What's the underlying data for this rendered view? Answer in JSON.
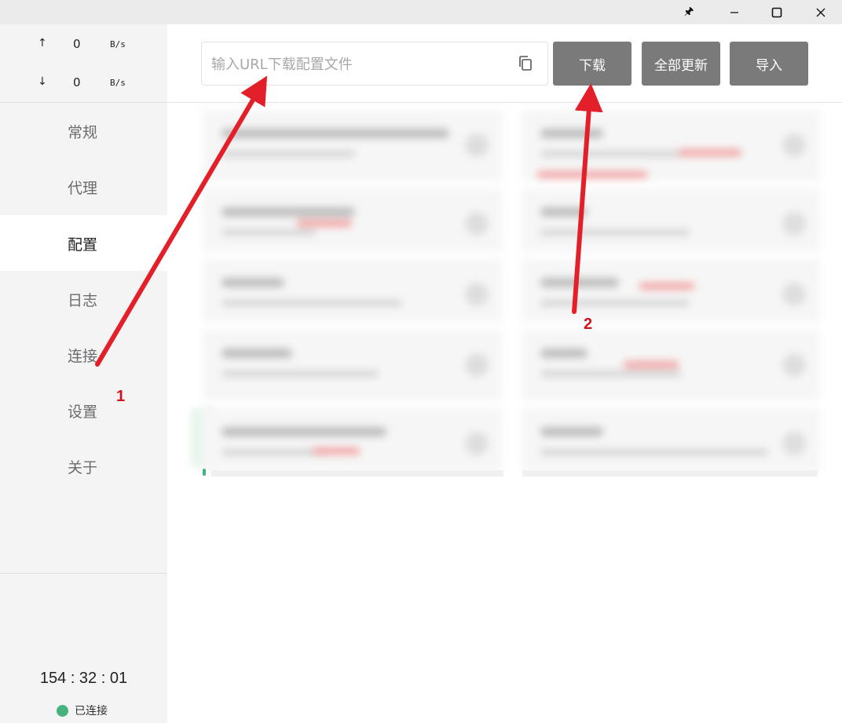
{
  "titlebar": {
    "icons": [
      "pin-icon",
      "minimize-icon",
      "maximize-icon",
      "close-icon"
    ],
    "pin": "🖈",
    "min": "—",
    "max": "☐",
    "close": "✕"
  },
  "traffic": {
    "up_arrow": "↑",
    "up_value": "0",
    "up_unit": "B/s",
    "down_arrow": "↓",
    "down_value": "0",
    "down_unit": "B/s"
  },
  "nav": {
    "items": [
      {
        "label": "常规",
        "active": false
      },
      {
        "label": "代理",
        "active": false
      },
      {
        "label": "配置",
        "active": true
      },
      {
        "label": "日志",
        "active": false
      },
      {
        "label": "连接",
        "active": false
      },
      {
        "label": "设置",
        "active": false
      },
      {
        "label": "关于",
        "active": false
      }
    ]
  },
  "status": {
    "timer": "154 : 32 : 01",
    "connection": "已连接",
    "color": "#46b27e"
  },
  "toolbar": {
    "url_placeholder": "输入URL下载配置文件",
    "url_value": "",
    "download_label": "下载",
    "update_all_label": "全部更新",
    "import_label": "导入",
    "button_color": "#7a7a7a"
  },
  "annotations": {
    "label_1": "1",
    "label_2": "2",
    "color": "#d0121b"
  }
}
